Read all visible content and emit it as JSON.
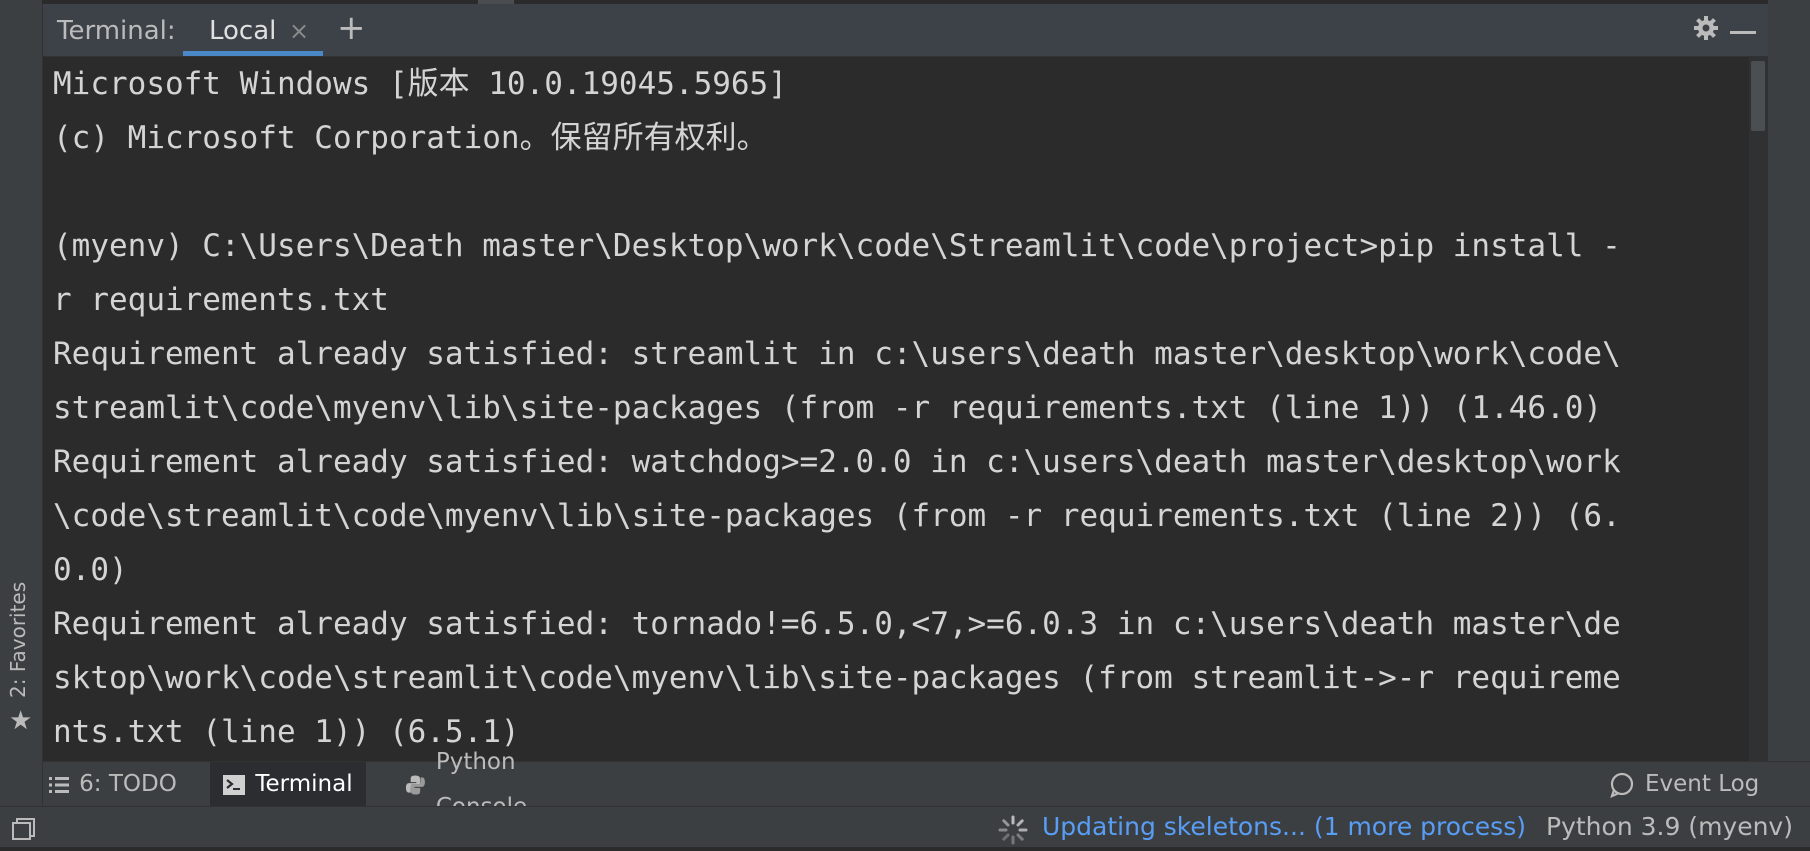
{
  "header": {
    "title": "Terminal:",
    "tab_label": "Local",
    "tab_close": "×",
    "add": "+"
  },
  "favorites": {
    "label": "2: Favorites"
  },
  "terminal": {
    "lines": [
      "Microsoft Windows [版本 10.0.19045.5965]",
      "(c) Microsoft Corporation。保留所有权利。",
      "",
      "(myenv) C:\\Users\\Death master\\Desktop\\work\\code\\Streamlit\\code\\project>pip install -",
      "r requirements.txt",
      "Requirement already satisfied: streamlit in c:\\users\\death master\\desktop\\work\\code\\",
      "streamlit\\code\\myenv\\lib\\site-packages (from -r requirements.txt (line 1)) (1.46.0)",
      "Requirement already satisfied: watchdog>=2.0.0 in c:\\users\\death master\\desktop\\work",
      "\\code\\streamlit\\code\\myenv\\lib\\site-packages (from -r requirements.txt (line 2)) (6.",
      "0.0)",
      "Requirement already satisfied: tornado!=6.5.0,<7,>=6.0.3 in c:\\users\\death master\\de",
      "sktop\\work\\code\\streamlit\\code\\myenv\\lib\\site-packages (from streamlit->-r requireme",
      "nts.txt (line 1)) (6.5.1)"
    ]
  },
  "bottom_tabs": {
    "todo": "6: TODO",
    "terminal": "Terminal",
    "python_console": "Python Console",
    "event_log": "Event Log"
  },
  "status": {
    "progress": "Updating skeletons... (1 more process)",
    "interpreter": "Python 3.9 (myenv)"
  },
  "colors": {
    "accent": "#4a88c7",
    "link": "#589df6"
  }
}
